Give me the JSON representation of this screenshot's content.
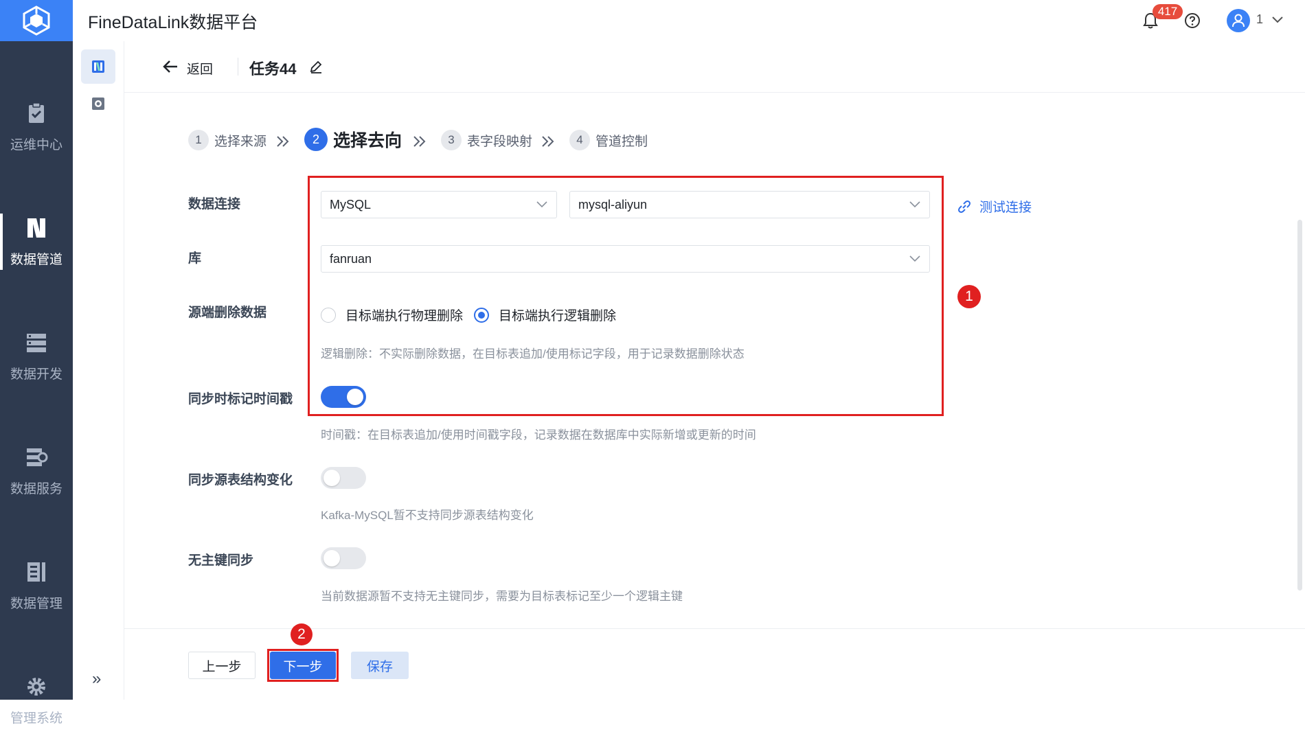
{
  "header": {
    "app_title": "FineDataLink数据平台",
    "notifications_count": "417",
    "user_name": "1"
  },
  "sidebar": {
    "items": [
      {
        "label": "运维中心",
        "icon": "clipboard-check-icon",
        "active": false
      },
      {
        "label": "数据管道",
        "icon": "pipeline-icon",
        "active": true
      },
      {
        "label": "数据开发",
        "icon": "database-dev-icon",
        "active": false
      },
      {
        "label": "数据服务",
        "icon": "data-service-icon",
        "active": false
      },
      {
        "label": "数据管理",
        "icon": "data-management-icon",
        "active": false
      },
      {
        "label": "管理系统",
        "icon": "gear-icon",
        "active": false
      }
    ]
  },
  "subheader": {
    "back_label": "返回",
    "task_title": "任务44"
  },
  "steps": [
    {
      "num": "1",
      "label": "选择来源",
      "active": false
    },
    {
      "num": "2",
      "label": "选择去向",
      "active": true
    },
    {
      "num": "3",
      "label": "表字段映射",
      "active": false
    },
    {
      "num": "4",
      "label": "管道控制",
      "active": false
    }
  ],
  "form": {
    "connection_label": "数据连接",
    "connection_type": "MySQL",
    "connection_name": "mysql-aliyun",
    "test_connection": "测试连接",
    "database_label": "库",
    "database_value": "fanruan",
    "delete_label": "源端删除数据",
    "delete_option_physical": "目标端执行物理删除",
    "delete_option_logical": "目标端执行逻辑删除",
    "delete_hint": "逻辑删除：不实际删除数据，在目标表追加/使用标记字段，用于记录数据删除状态",
    "timestamp_label": "同步时标记时间戳",
    "timestamp_enabled": true,
    "timestamp_hint": "时间戳：在目标表追加/使用时间戳字段，记录数据在数据库中实际新增或更新的时间",
    "schema_change_label": "同步源表结构变化",
    "schema_change_enabled": false,
    "schema_change_hint": "Kafka-MySQL暂不支持同步源表结构变化",
    "no_pk_label": "无主键同步",
    "no_pk_enabled": false,
    "no_pk_hint": "当前数据源暂不支持无主键同步，需要为目标表标记至少一个逻辑主键"
  },
  "footer": {
    "prev_label": "上一步",
    "next_label": "下一步",
    "save_label": "保存"
  },
  "annotations": {
    "marker_1": "1",
    "marker_2": "2",
    "color": "#e02020"
  },
  "colors": {
    "primary": "#2f6ee8",
    "sidebar_bg": "#2e3a4f",
    "logo_bg": "#3b82f6"
  }
}
